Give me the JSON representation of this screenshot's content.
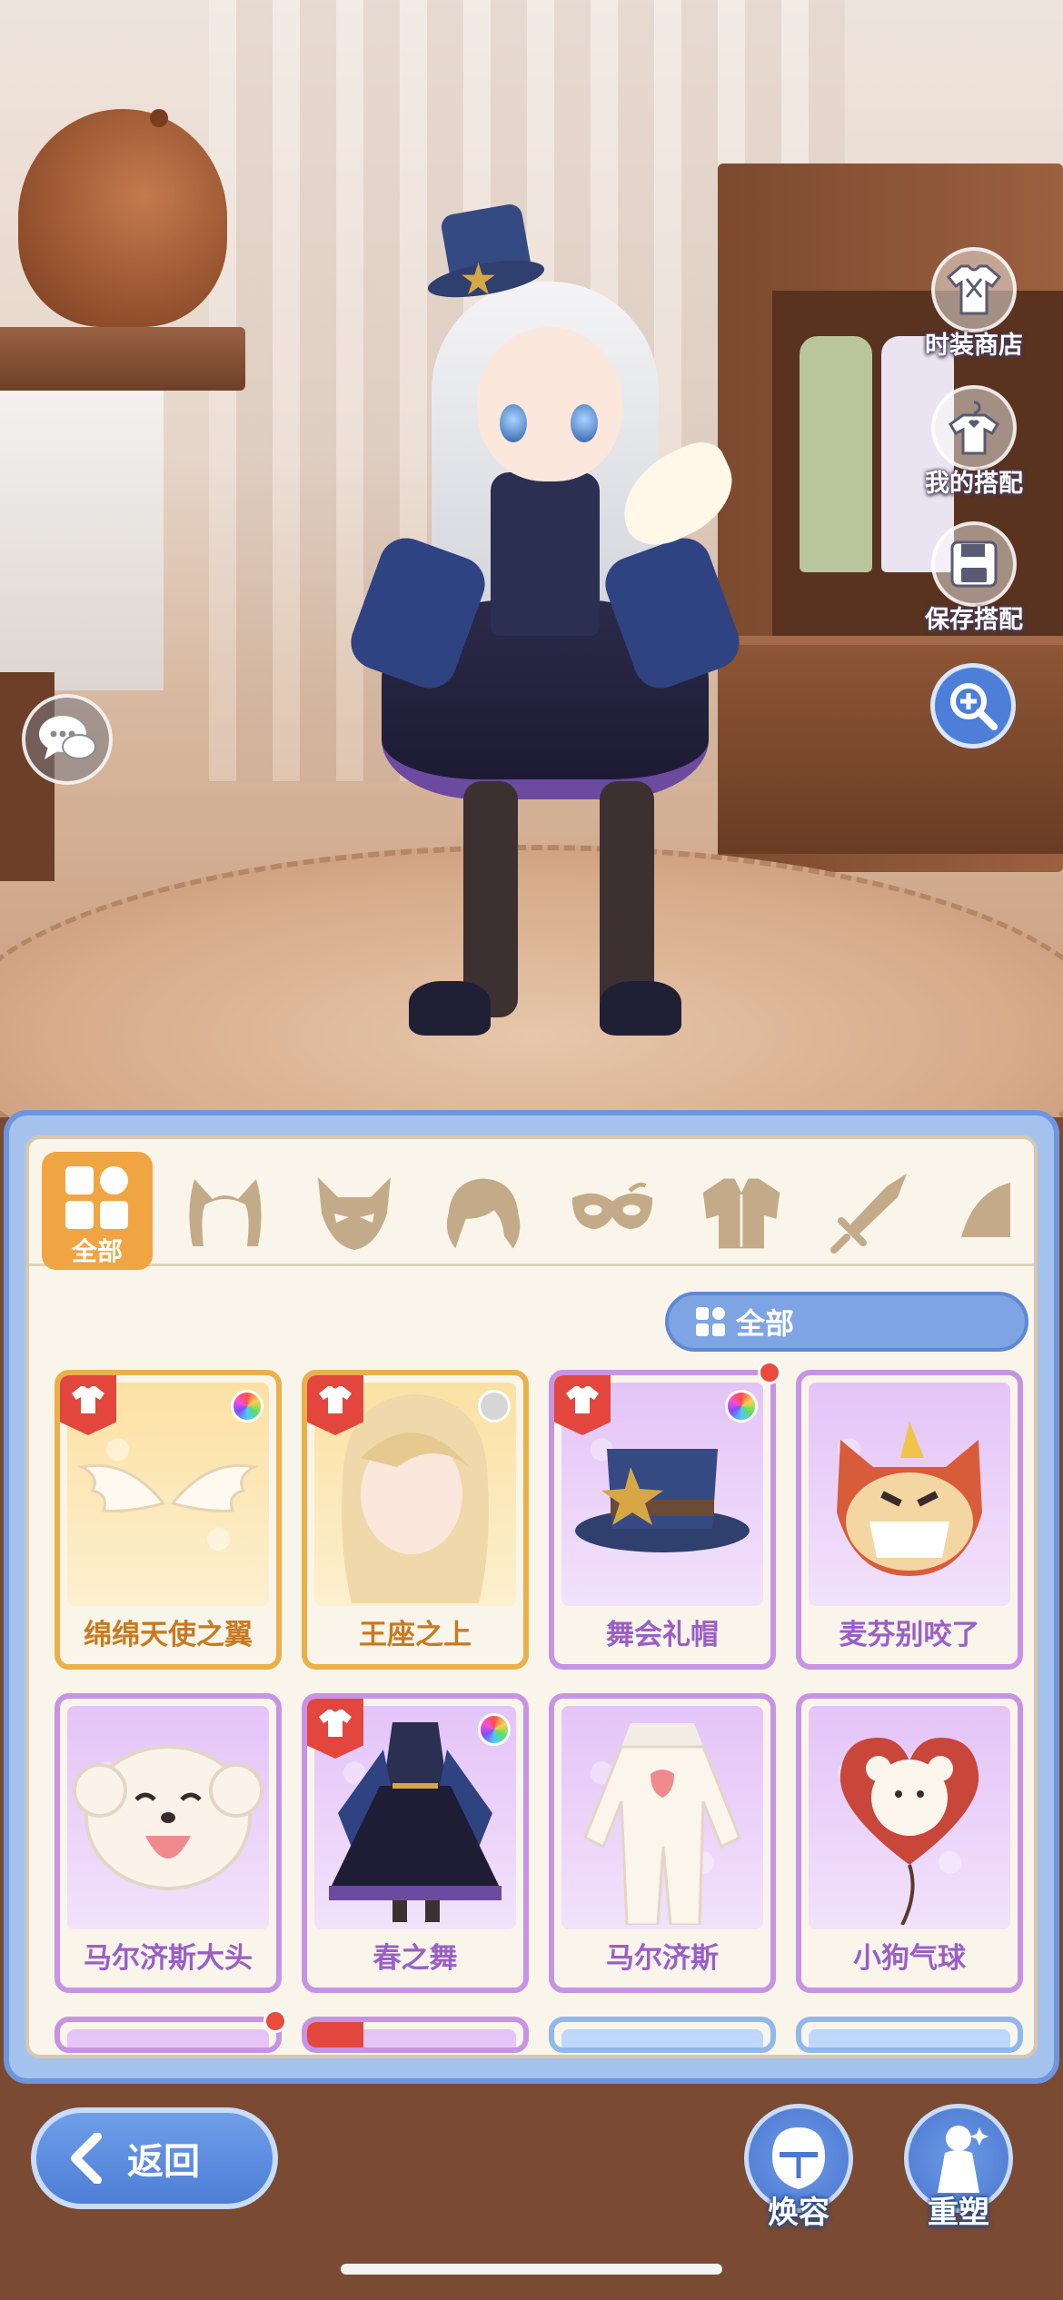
{
  "side_menu": {
    "shop": "时装商店",
    "my_outfits": "我的搭配",
    "save_outfit": "保存搭配"
  },
  "category_tabs": {
    "all_label": "全部",
    "icons": [
      "cat-ears-icon",
      "fox-mask-icon",
      "hair-icon",
      "eye-mask-icon",
      "outfit-icon",
      "sword-icon",
      "wing-icon"
    ]
  },
  "filter": {
    "label": "全部"
  },
  "items": [
    {
      "name": "绵绵天使之翼",
      "rarity": "gold",
      "color_swatch": "rainbow",
      "tag": true,
      "new": false
    },
    {
      "name": "王座之上",
      "rarity": "gold",
      "color_swatch": "grey",
      "tag": true,
      "new": false
    },
    {
      "name": "舞会礼帽",
      "rarity": "purple",
      "color_swatch": "rainbow",
      "tag": true,
      "new": true
    },
    {
      "name": "麦芬别咬了",
      "rarity": "purple",
      "color_swatch": null,
      "tag": false,
      "new": false
    },
    {
      "name": "马尔济斯大头",
      "rarity": "purple",
      "color_swatch": null,
      "tag": false,
      "new": false
    },
    {
      "name": "春之舞",
      "rarity": "purple",
      "color_swatch": "rainbow",
      "tag": true,
      "new": false
    },
    {
      "name": "马尔济斯",
      "rarity": "purple",
      "color_swatch": null,
      "tag": false,
      "new": false
    },
    {
      "name": "小狗气球",
      "rarity": "purple",
      "color_swatch": null,
      "tag": false,
      "new": false
    }
  ],
  "bottom_bar": {
    "back": "返回",
    "face": "焕容",
    "reshape": "重塑"
  },
  "colors": {
    "accent_blue": "#4e7ed6",
    "orange_tab": "#f0a542",
    "purple_rarity": "#c793e4",
    "gold_rarity": "#eab04a",
    "new_dot": "#e94b3c"
  }
}
